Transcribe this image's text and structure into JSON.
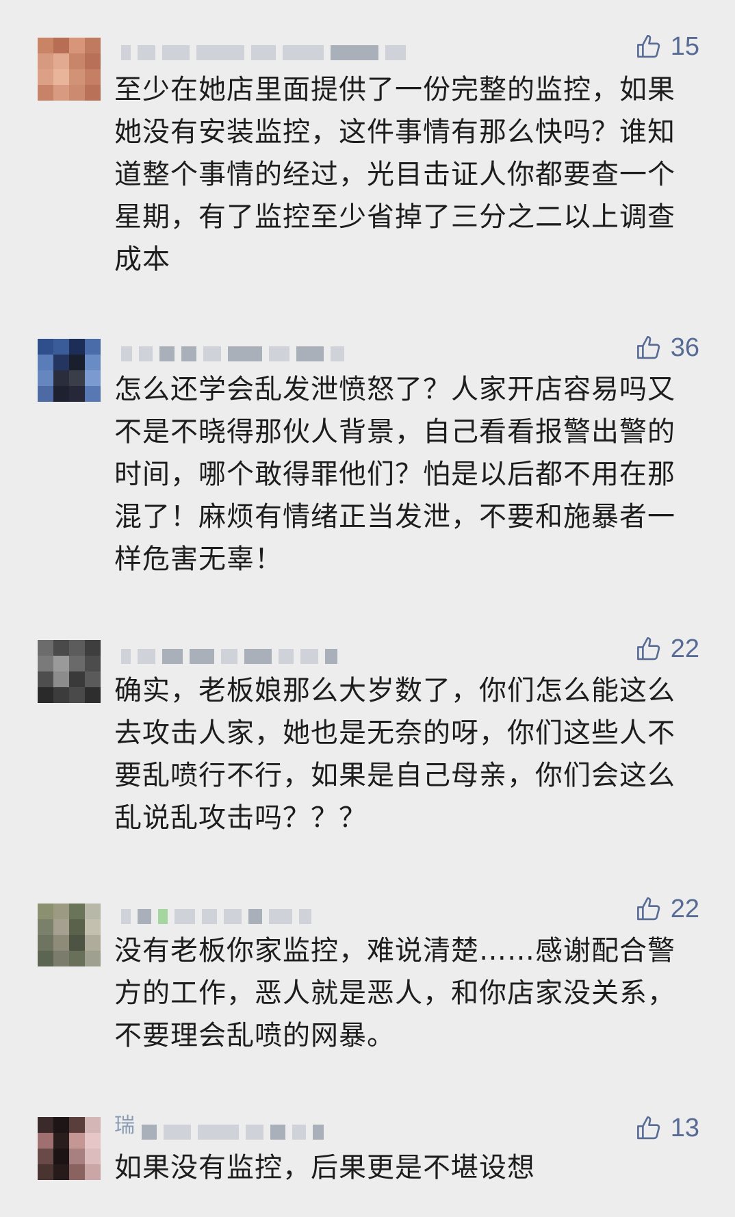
{
  "comments": [
    {
      "nickname": "",
      "likes": "15",
      "text": "至少在她店里面提供了一份完整的监控，如果她没有安装监控，这件事情有那么快吗？谁知道整个事情的经过，光目击证人你都要查一个星期，有了监控至少省掉了三分之二以上调查成本"
    },
    {
      "nickname": "",
      "likes": "36",
      "text": "怎么还学会乱发泄愤怒了？人家开店容易吗又不是不晓得那伙人背景，自己看看报警出警的时间，哪个敢得罪他们？怕是以后都不用在那混了！麻烦有情绪正当发泄，不要和施暴者一样危害无辜！"
    },
    {
      "nickname": "",
      "likes": "22",
      "text": "确实，老板娘那么大岁数了，你们怎么能这么去攻击人家，她也是无奈的呀，你们这些人不要乱喷行不行，如果是自己母亲，你们会这么乱说乱攻击吗？？？"
    },
    {
      "nickname": "",
      "likes": "22",
      "text": "没有老板你家监控，难说清楚……感谢配合警方的工作，恶人就是恶人，和你店家没关系，不要理会乱喷的网暴。"
    },
    {
      "nickname": "瑞",
      "likes": "13",
      "text": "如果没有监控，后果更是不堪设想"
    }
  ],
  "colors": {
    "background": "#ededed",
    "like": "#576b95",
    "nickname": "#8a9bb4",
    "text": "#1d1d1d"
  },
  "icons": {
    "like": "thumbs-up-icon"
  }
}
